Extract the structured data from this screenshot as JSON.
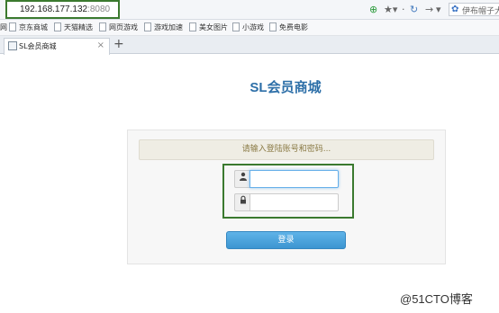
{
  "browser": {
    "url_host": "192.168.177.132",
    "url_port": ":8080",
    "search_placeholder": "伊布帽子大",
    "bookmarks_prefix": "网",
    "bookmarks": [
      {
        "label": "京东商城"
      },
      {
        "label": "天猫精选"
      },
      {
        "label": "网页游戏"
      },
      {
        "label": "游戏加速"
      },
      {
        "label": "美女图片"
      },
      {
        "label": "小游戏"
      },
      {
        "label": "免费电影"
      }
    ],
    "tab": {
      "title": "SL会员商城",
      "close": "×"
    },
    "new_tab": "+"
  },
  "page": {
    "title": "SL会员商城",
    "notice": "请输入登陆账号和密码...",
    "username_value": "",
    "password_value": "",
    "login_label": "登录"
  },
  "watermark": "@51CTO博客",
  "colors": {
    "title": "#2d6fa8",
    "highlight_box": "#3b7a2f",
    "login_button": "#4aa3dc",
    "notice_text": "#8a7a45"
  },
  "icons": {
    "user_field": "user-icon",
    "password_field": "lock-icon"
  }
}
